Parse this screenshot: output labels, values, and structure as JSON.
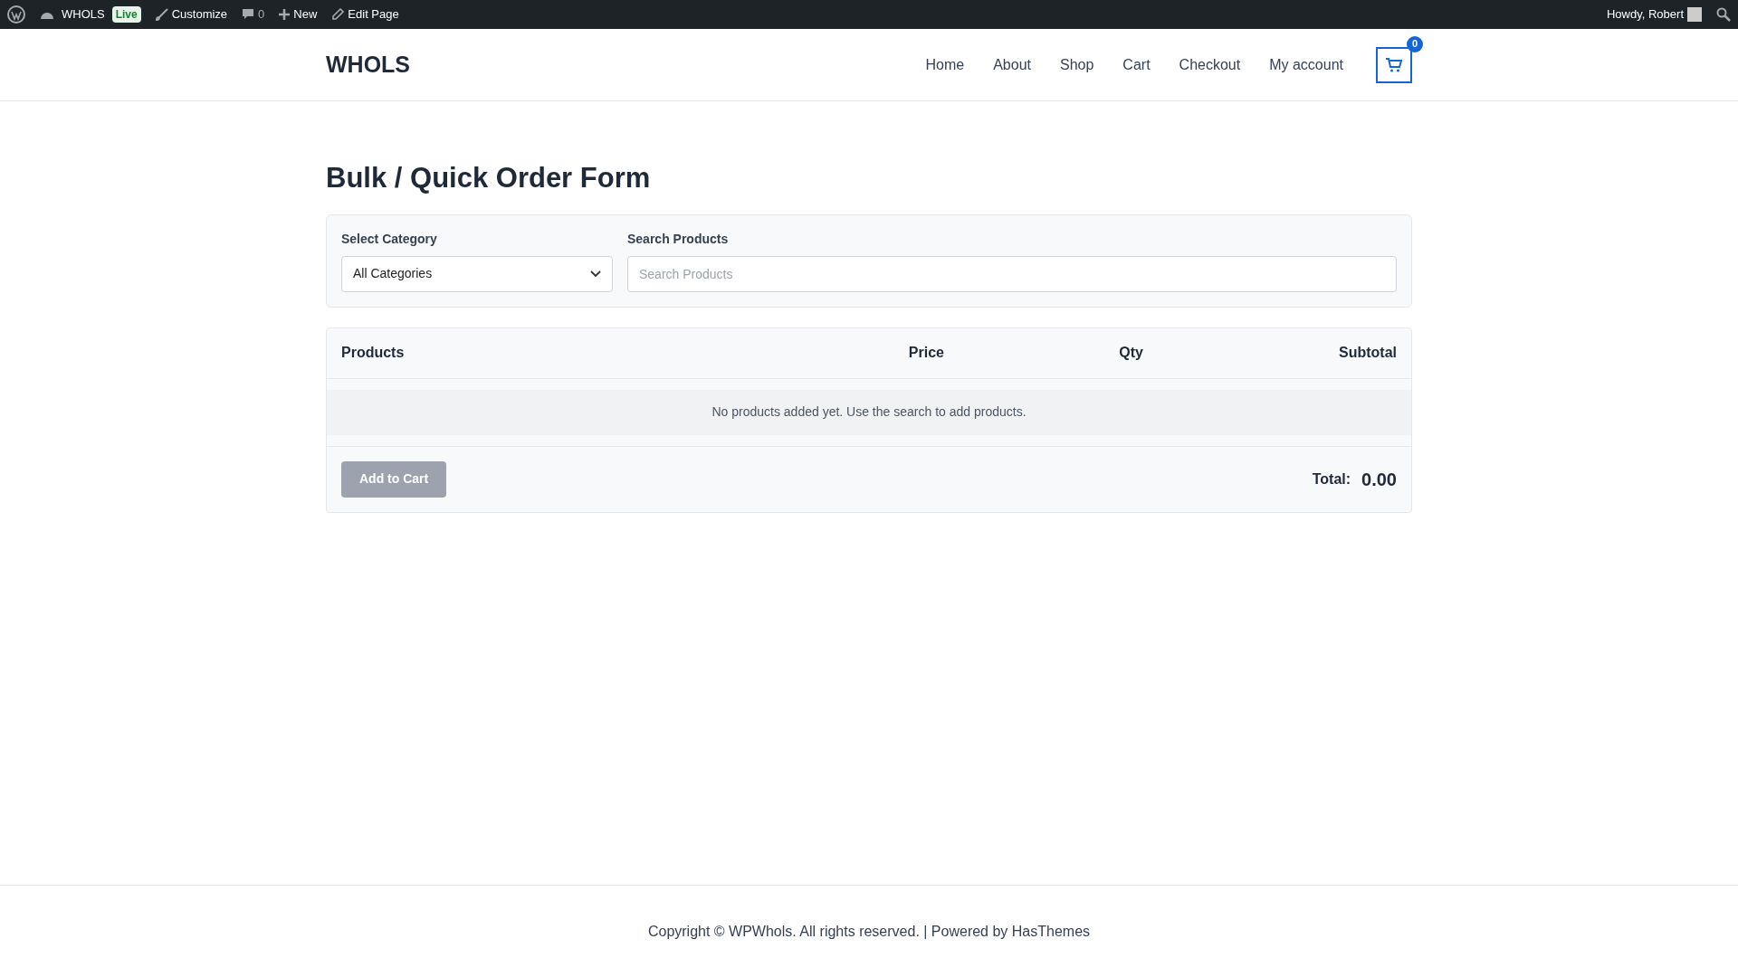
{
  "admin_bar": {
    "site": "WHOLS",
    "live_badge": "Live",
    "customize": "Customize",
    "comments": "0",
    "new": "New",
    "edit_page": "Edit Page",
    "greeting": "Howdy, Robert"
  },
  "header": {
    "logo": "WHOLS",
    "nav": [
      {
        "label": "Home"
      },
      {
        "label": "About"
      },
      {
        "label": "Shop"
      },
      {
        "label": "Cart"
      },
      {
        "label": "Checkout"
      },
      {
        "label": "My account"
      }
    ],
    "cart_count": "0"
  },
  "page_title": "Bulk / Quick Order Form",
  "filters": {
    "category_label": "Select Category",
    "category_value": "All Categories",
    "search_label": "Search Products",
    "search_placeholder": "Search Products"
  },
  "table": {
    "columns": [
      "Products",
      "Price",
      "Qty",
      "Subtotal"
    ],
    "empty_message": "No products added yet. Use the search to add products."
  },
  "add_to_cart": {
    "label": "Add to Cart",
    "disabled": true
  },
  "total": {
    "label": "Total:",
    "value": "0.00"
  },
  "footer": "Copyright © WPWhols. All rights reserved. | Powered by HasThemes"
}
